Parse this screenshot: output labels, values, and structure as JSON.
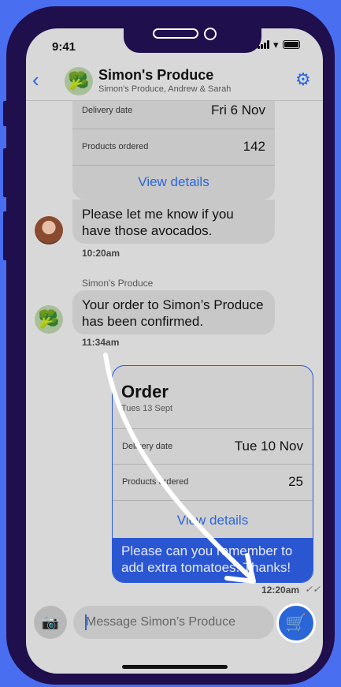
{
  "status": {
    "time": "9:41"
  },
  "header": {
    "back_icon": "chevron-left-icon",
    "title": "Simon's Produce",
    "subtitle": "Simon's Produce, Andrew & Sarah",
    "settings_icon": "gear-icon"
  },
  "order_summary": {
    "rows": [
      {
        "label": "Delivery date",
        "value": "Fri 6 Nov"
      },
      {
        "label": "Products ordered",
        "value": "142"
      }
    ],
    "link": "View details"
  },
  "messages": {
    "user_message": "Please let me know if you have those avocados.",
    "user_time": "10:20am",
    "sender_name": "Simon's Produce",
    "produce_message": "Your order to Simon’s Produce has been confirmed.",
    "produce_time": "11:34am"
  },
  "order_card": {
    "title": "Order",
    "date": "Tues 13 Sept",
    "rows": [
      {
        "label": "Delivery date",
        "value": "Tue 10 Nov"
      },
      {
        "label": "Products ordered",
        "value": "25"
      }
    ],
    "link": "View details",
    "message": "Please can you remember to add extra tomatoes. Thanks!",
    "time": "12:20am",
    "read_status": "✓✓"
  },
  "composer": {
    "placeholder": "Message Simon’s Produce"
  },
  "colors": {
    "accent": "#2b66d9",
    "frame": "#1f0f4d",
    "background": "#4a6ef0"
  }
}
